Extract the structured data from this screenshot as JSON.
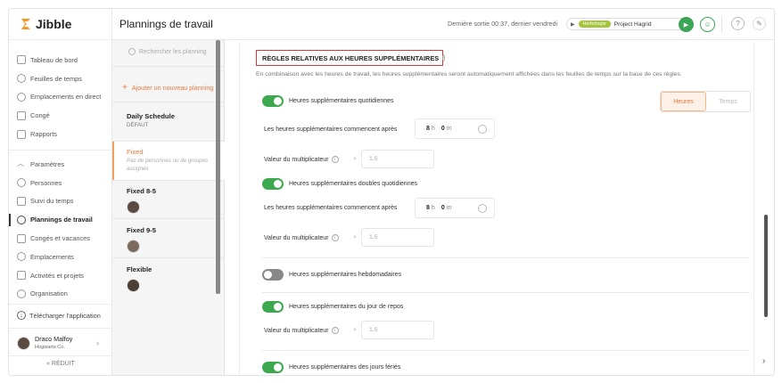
{
  "app": {
    "name": "Jibble"
  },
  "sidebar": {
    "items": [
      {
        "label": "Tableau de bord",
        "icon": "dashboard-icon"
      },
      {
        "label": "Feuilles de temps",
        "icon": "clock-icon"
      },
      {
        "label": "Emplacements en direct",
        "icon": "location-icon"
      },
      {
        "label": "Congé",
        "icon": "calendar-icon"
      },
      {
        "label": "Rapports",
        "icon": "report-icon"
      }
    ],
    "settings_items": [
      {
        "label": "Paramètres",
        "icon": "chevron-up-icon"
      },
      {
        "label": "Personnes",
        "icon": "people-icon"
      },
      {
        "label": "Suivi du temps",
        "icon": "time-tracking-icon"
      },
      {
        "label": "Plannings de travail",
        "icon": "schedule-icon",
        "active": true
      },
      {
        "label": "Congés et vacances",
        "icon": "holiday-icon"
      },
      {
        "label": "Emplacements",
        "icon": "location-icon"
      },
      {
        "label": "Activités et projets",
        "icon": "tag-icon"
      },
      {
        "label": "Organisation",
        "icon": "organisation-icon"
      }
    ],
    "download": "Télécharger l'application",
    "user": {
      "name": "Draco Malfoy",
      "org": "Hogwarts Co."
    },
    "reduce": "RÉDUIT"
  },
  "header": {
    "title": "Plannings de travail",
    "last_out": "Dernière sortie 00:37, dernier vendredi",
    "time_tag": "Herbologie",
    "project": "Project Hagrid"
  },
  "schedules": {
    "search_placeholder": "Rechercher les planning",
    "add_label": "Ajouter un nouveau planning",
    "items": [
      {
        "name": "Daily Schedule",
        "sub": "DÉFAUT"
      },
      {
        "name": "Fixed",
        "sub": "Pas de personnes ou de groupes assignés"
      },
      {
        "name": "Fixed 8-5",
        "sub": ""
      },
      {
        "name": "Fixed 9-5",
        "sub": ""
      },
      {
        "name": "Flexible",
        "sub": ""
      }
    ]
  },
  "overtime": {
    "section_title": "RÈGLES RELATIVES AUX HEURES SUPPLÉMENTAIRES",
    "description": "En combinaison avec les heures de travail, les heures supplémentaires seront automatiquement affichées dans les feuilles de temps sur la base de ces règles.",
    "unit_options": [
      "Heures",
      "Temps"
    ],
    "unit_selected": "Heures",
    "daily": {
      "label": "Heures supplémentaires quotidiennes",
      "enabled": true,
      "start_label": "Les heures supplémentaires commencent après",
      "hours": "8",
      "minutes": "0",
      "mult_label": "Valeur du multiplicateur",
      "mult": "1.5"
    },
    "double_daily": {
      "label": "Heures supplémentaires doubles quotidiennes",
      "enabled": true,
      "start_label": "Les heures supplémentaires commencent après",
      "hours": "8",
      "minutes": "0",
      "mult_label": "Valeur du multiplicateur",
      "mult": "1.5"
    },
    "weekly": {
      "label": "Heures supplémentaires hebdomadaires",
      "enabled": false
    },
    "rest_day": {
      "label": "Heures supplémentaires du jour de repos",
      "enabled": true,
      "mult_label": "Valeur du multiplicateur",
      "mult": "1.5"
    },
    "holidays": {
      "label": "Heures supplémentaires des jours fériés",
      "enabled": true
    },
    "h_unit": "h",
    "m_unit": "m",
    "x": "×"
  }
}
